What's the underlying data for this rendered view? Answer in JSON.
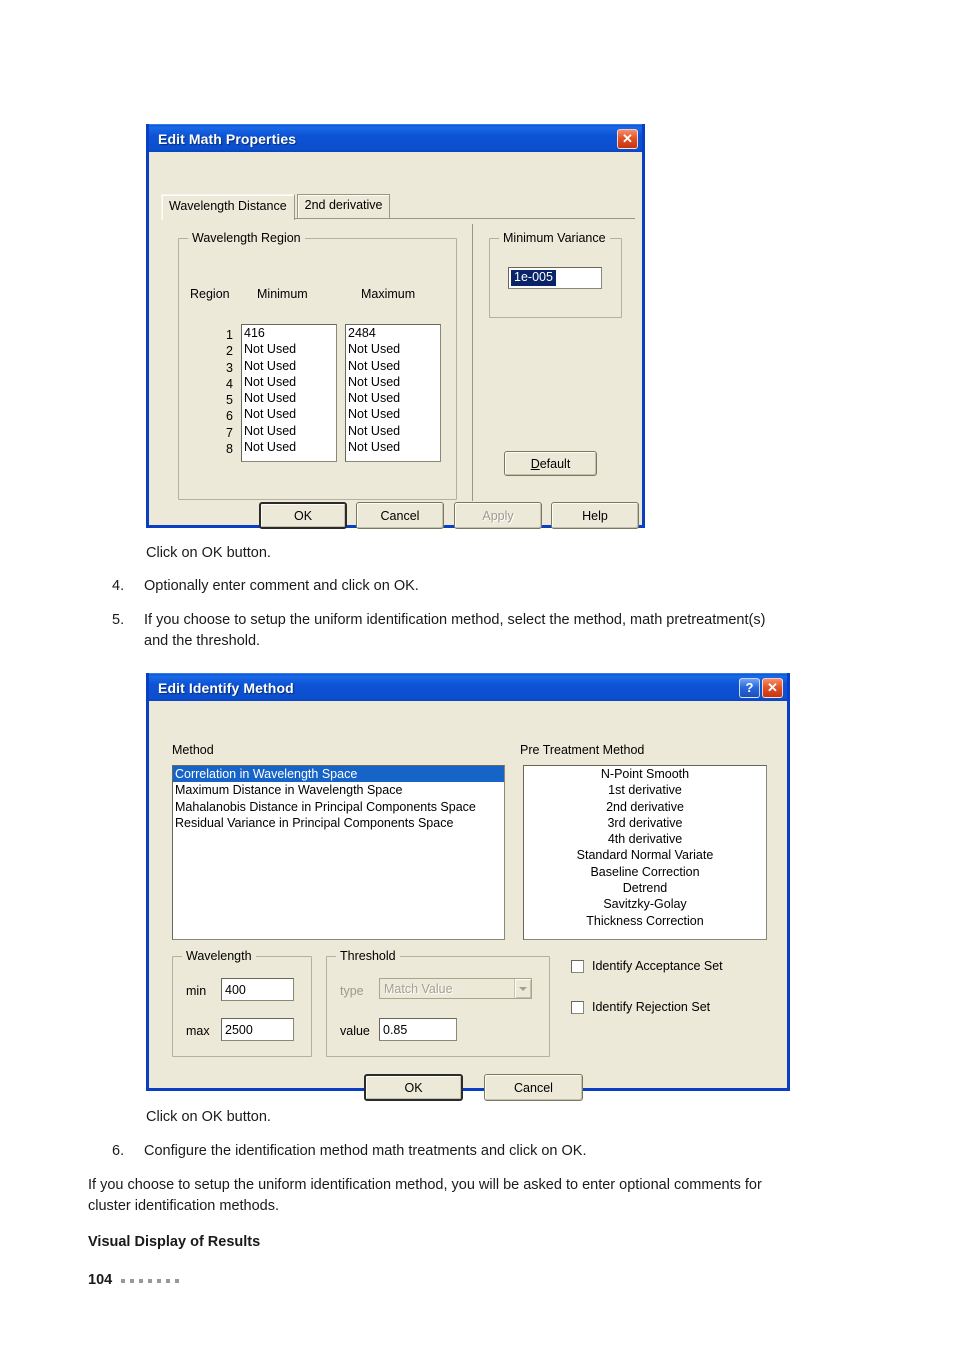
{
  "document": {
    "caption_after_dialog1": "Click on OK button.",
    "step4": {
      "num": "4.",
      "text": "Optionally enter comment and click on OK."
    },
    "step5": {
      "num": "5.",
      "text": "If you choose to setup the uniform identification method, select the method, math pretreatment(s) and the threshold."
    },
    "caption_after_dialog2": "Click on OK button.",
    "step6": {
      "num": "6.",
      "text": "Configure the identification method math treatments and click on OK."
    },
    "closing_paragraph": "If you choose to setup the uniform identification method, you will be asked to enter optional comments for cluster identification methods.",
    "section_heading": "Visual Display of Results",
    "page_number": "104"
  },
  "dialog_math": {
    "title": "Edit Math Properties",
    "close_icon": "close-icon",
    "close_glyph": "✕",
    "tabs": [
      {
        "label": "Wavelength Distance",
        "active": true
      },
      {
        "label": "2nd derivative",
        "active": false
      }
    ],
    "wavelength_region": {
      "legend": "Wavelength Region",
      "columns": [
        "Region",
        "Minimum",
        "Maximum"
      ],
      "rows": [
        {
          "region": "1",
          "minimum": "416",
          "maximum": "2484"
        },
        {
          "region": "2",
          "minimum": "Not Used",
          "maximum": "Not Used"
        },
        {
          "region": "3",
          "minimum": "Not Used",
          "maximum": "Not Used"
        },
        {
          "region": "4",
          "minimum": "Not Used",
          "maximum": "Not Used"
        },
        {
          "region": "5",
          "minimum": "Not Used",
          "maximum": "Not Used"
        },
        {
          "region": "6",
          "minimum": "Not Used",
          "maximum": "Not Used"
        },
        {
          "region": "7",
          "minimum": "Not Used",
          "maximum": "Not Used"
        },
        {
          "region": "8",
          "minimum": "Not Used",
          "maximum": "Not Used"
        }
      ]
    },
    "minimum_variance": {
      "legend": "Minimum Variance",
      "value": "1e-005",
      "selected": true
    },
    "default_button": {
      "label": "Default",
      "accesskey": "D"
    },
    "buttons": {
      "ok": "OK",
      "cancel": "Cancel",
      "apply": "Apply",
      "apply_disabled": true,
      "help": "Help"
    }
  },
  "dialog_identify": {
    "title": "Edit Identify Method",
    "help_glyph": "?",
    "close_glyph": "✕",
    "method": {
      "label": "Method",
      "items": [
        "Correlation in Wavelength Space",
        "Maximum Distance in Wavelength Space",
        "Mahalanobis Distance in Principal Components Space",
        "Residual Variance in Principal Components Space"
      ],
      "selected_index": 0
    },
    "pre_treatment": {
      "label": "Pre Treatment Method",
      "items": [
        "N-Point Smooth",
        "1st derivative",
        "2nd derivative",
        "3rd derivative",
        "4th derivative",
        "Standard Normal Variate",
        "Baseline Correction",
        "Detrend",
        "Savitzky-Golay",
        "Thickness Correction"
      ]
    },
    "wavelength": {
      "legend": "Wavelength",
      "min_label": "min",
      "min_value": "400",
      "max_label": "max",
      "max_value": "2500"
    },
    "threshold": {
      "legend": "Threshold",
      "type_label": "type",
      "type_value": "Match Value",
      "type_disabled": true,
      "value_label": "value",
      "value_value": "0.85"
    },
    "checkboxes": [
      {
        "label": "Identify Acceptance Set",
        "checked": false
      },
      {
        "label": "Identify Rejection Set",
        "checked": false
      }
    ],
    "buttons": {
      "ok": "OK",
      "cancel": "Cancel"
    }
  }
}
